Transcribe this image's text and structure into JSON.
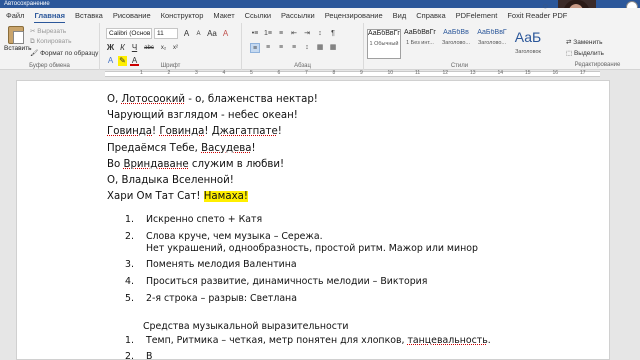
{
  "titlebar": {
    "quick_access": "Автосохранение"
  },
  "tabs": [
    "Файл",
    "Главная",
    "Вставка",
    "Рисование",
    "Конструктор",
    "Макет",
    "Ссылки",
    "Рассылки",
    "Рецензирование",
    "Вид",
    "Справка",
    "PDFelement",
    "Foxit Reader PDF"
  ],
  "active_tab": "Главная",
  "tab_extra": {
    "share": "Помо"
  },
  "clipboard": {
    "paste": "Вставить",
    "cut": "Вырезать",
    "copy": "Копировать",
    "format_painter": "Формат по образцу",
    "label": "Буфер обмена"
  },
  "font": {
    "family": "Calibri (Основ",
    "size": "11",
    "label": "Шрифт",
    "row1": [
      "A",
      "A",
      "Aa",
      "A"
    ],
    "row2": [
      "Ж",
      "К",
      "Ч",
      "abc",
      "x₂",
      "x²"
    ],
    "row3": [
      "A",
      "✎",
      "A"
    ]
  },
  "paragraph": {
    "label": "Абзац",
    "row1": [
      "•≡",
      "1≡",
      "≡",
      "⇤",
      "⇥",
      "↕",
      "¶"
    ],
    "row2": [
      "≡",
      "≡",
      "≡",
      "≡",
      "↕",
      "▦",
      "▦"
    ]
  },
  "styles": {
    "label": "Стили",
    "items": [
      {
        "sample": "АаБбВвГг",
        "name": "1 Обычный"
      },
      {
        "sample": "АаБбВвГг",
        "name": "1 Без инт..."
      },
      {
        "sample": "АаБбВв",
        "name": "Заголово..."
      },
      {
        "sample": "АаБбВвГ",
        "name": "Заголово..."
      },
      {
        "sample": "АаБ",
        "name": "Заголовок"
      }
    ]
  },
  "editing": {
    "replace": "Заменить",
    "select": "Выделить",
    "label": "Редактирование"
  },
  "webcam": {
    "name": "chevea"
  },
  "ruler": {
    "marks": [
      "1",
      "2",
      "3",
      "4",
      "5",
      "6",
      "7",
      "8",
      "9",
      "10",
      "11",
      "12",
      "13",
      "14",
      "15",
      "16",
      "17"
    ]
  },
  "document": {
    "poem": [
      [
        {
          "t": "О, "
        },
        {
          "t": "Лотосоокий",
          "u": true
        },
        {
          "t": " - о, блаженства нектар!"
        }
      ],
      [
        {
          "t": "Чарующий взглядом - небес океан!"
        }
      ],
      [
        {
          "t": "Говинда",
          "u": true
        },
        {
          "t": "! "
        },
        {
          "t": "Говинда",
          "u": true
        },
        {
          "t": "! "
        },
        {
          "t": "Джагатпате",
          "u": true
        },
        {
          "t": "!"
        }
      ],
      [
        {
          "t": "Предаёмся Тебе, "
        },
        {
          "t": "Васудева",
          "u": true
        },
        {
          "t": "!"
        }
      ],
      [
        {
          "t": "Во "
        },
        {
          "t": "Вриндаване",
          "u": true
        },
        {
          "t": " служим в любви!"
        }
      ],
      [
        {
          "t": "О, Владыка Вселенной!"
        }
      ],
      [
        {
          "t": "Хари Ом Тат Сат! "
        },
        {
          "t": "Намаха!",
          "h": true
        }
      ]
    ],
    "list": [
      {
        "n": "1.",
        "text": "Искренно спето + Катя"
      },
      {
        "n": "2.",
        "text": "Слова круче, чем музыка – Сережа."
      },
      {
        "n": "",
        "text": "Нет украшений, однообразность, простой ритм. Мажор или минор"
      },
      {
        "n": "3.",
        "text": "Поменять мелодия Валентина"
      },
      {
        "n": "4.",
        "text": "Проситься развитие, динамичность мелодии – Виктория"
      },
      {
        "n": "5.",
        "text": "2-я строка – разрыв: Светлана"
      }
    ],
    "heading2": "Средства музыкальной выразительности",
    "list2": [
      {
        "n": "1.",
        "pre": "Темп, Ритмика – четкая, метр понятен для хлопков, ",
        "u": "танцевальность",
        "post": "."
      },
      {
        "n": "2.",
        "pre": "В",
        "u": "",
        "post": ""
      }
    ]
  }
}
